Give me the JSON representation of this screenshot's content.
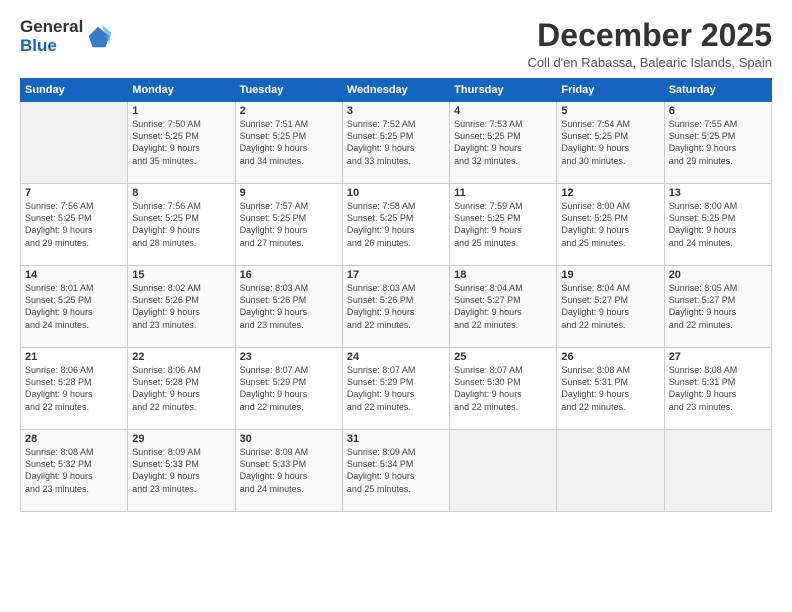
{
  "logo": {
    "general": "General",
    "blue": "Blue"
  },
  "title": "December 2025",
  "location": "Coll d'en Rabassa, Balearic Islands, Spain",
  "headers": [
    "Sunday",
    "Monday",
    "Tuesday",
    "Wednesday",
    "Thursday",
    "Friday",
    "Saturday"
  ],
  "weeks": [
    [
      {
        "day": "",
        "info": ""
      },
      {
        "day": "1",
        "info": "Sunrise: 7:50 AM\nSunset: 5:25 PM\nDaylight: 9 hours\nand 35 minutes."
      },
      {
        "day": "2",
        "info": "Sunrise: 7:51 AM\nSunset: 5:25 PM\nDaylight: 9 hours\nand 34 minutes."
      },
      {
        "day": "3",
        "info": "Sunrise: 7:52 AM\nSunset: 5:25 PM\nDaylight: 9 hours\nand 33 minutes."
      },
      {
        "day": "4",
        "info": "Sunrise: 7:53 AM\nSunset: 5:25 PM\nDaylight: 9 hours\nand 32 minutes."
      },
      {
        "day": "5",
        "info": "Sunrise: 7:54 AM\nSunset: 5:25 PM\nDaylight: 9 hours\nand 30 minutes."
      },
      {
        "day": "6",
        "info": "Sunrise: 7:55 AM\nSunset: 5:25 PM\nDaylight: 9 hours\nand 29 minutes."
      }
    ],
    [
      {
        "day": "7",
        "info": "Sunrise: 7:56 AM\nSunset: 5:25 PM\nDaylight: 9 hours\nand 29 minutes."
      },
      {
        "day": "8",
        "info": "Sunrise: 7:56 AM\nSunset: 5:25 PM\nDaylight: 9 hours\nand 28 minutes."
      },
      {
        "day": "9",
        "info": "Sunrise: 7:57 AM\nSunset: 5:25 PM\nDaylight: 9 hours\nand 27 minutes."
      },
      {
        "day": "10",
        "info": "Sunrise: 7:58 AM\nSunset: 5:25 PM\nDaylight: 9 hours\nand 26 minutes."
      },
      {
        "day": "11",
        "info": "Sunrise: 7:59 AM\nSunset: 5:25 PM\nDaylight: 9 hours\nand 25 minutes."
      },
      {
        "day": "12",
        "info": "Sunrise: 8:00 AM\nSunset: 5:25 PM\nDaylight: 9 hours\nand 25 minutes."
      },
      {
        "day": "13",
        "info": "Sunrise: 8:00 AM\nSunset: 5:25 PM\nDaylight: 9 hours\nand 24 minutes."
      }
    ],
    [
      {
        "day": "14",
        "info": "Sunrise: 8:01 AM\nSunset: 5:25 PM\nDaylight: 9 hours\nand 24 minutes."
      },
      {
        "day": "15",
        "info": "Sunrise: 8:02 AM\nSunset: 5:26 PM\nDaylight: 9 hours\nand 23 minutes."
      },
      {
        "day": "16",
        "info": "Sunrise: 8:03 AM\nSunset: 5:26 PM\nDaylight: 9 hours\nand 23 minutes."
      },
      {
        "day": "17",
        "info": "Sunrise: 8:03 AM\nSunset: 5:26 PM\nDaylight: 9 hours\nand 22 minutes."
      },
      {
        "day": "18",
        "info": "Sunrise: 8:04 AM\nSunset: 5:27 PM\nDaylight: 9 hours\nand 22 minutes."
      },
      {
        "day": "19",
        "info": "Sunrise: 8:04 AM\nSunset: 5:27 PM\nDaylight: 9 hours\nand 22 minutes."
      },
      {
        "day": "20",
        "info": "Sunrise: 8:05 AM\nSunset: 5:27 PM\nDaylight: 9 hours\nand 22 minutes."
      }
    ],
    [
      {
        "day": "21",
        "info": "Sunrise: 8:06 AM\nSunset: 5:28 PM\nDaylight: 9 hours\nand 22 minutes."
      },
      {
        "day": "22",
        "info": "Sunrise: 8:06 AM\nSunset: 5:28 PM\nDaylight: 9 hours\nand 22 minutes."
      },
      {
        "day": "23",
        "info": "Sunrise: 8:07 AM\nSunset: 5:29 PM\nDaylight: 9 hours\nand 22 minutes."
      },
      {
        "day": "24",
        "info": "Sunrise: 8:07 AM\nSunset: 5:29 PM\nDaylight: 9 hours\nand 22 minutes."
      },
      {
        "day": "25",
        "info": "Sunrise: 8:07 AM\nSunset: 5:30 PM\nDaylight: 9 hours\nand 22 minutes."
      },
      {
        "day": "26",
        "info": "Sunrise: 8:08 AM\nSunset: 5:31 PM\nDaylight: 9 hours\nand 22 minutes."
      },
      {
        "day": "27",
        "info": "Sunrise: 8:08 AM\nSunset: 5:31 PM\nDaylight: 9 hours\nand 23 minutes."
      }
    ],
    [
      {
        "day": "28",
        "info": "Sunrise: 8:08 AM\nSunset: 5:32 PM\nDaylight: 9 hours\nand 23 minutes."
      },
      {
        "day": "29",
        "info": "Sunrise: 8:09 AM\nSunset: 5:33 PM\nDaylight: 9 hours\nand 23 minutes."
      },
      {
        "day": "30",
        "info": "Sunrise: 8:09 AM\nSunset: 5:33 PM\nDaylight: 9 hours\nand 24 minutes."
      },
      {
        "day": "31",
        "info": "Sunrise: 8:09 AM\nSunset: 5:34 PM\nDaylight: 9 hours\nand 25 minutes."
      },
      {
        "day": "",
        "info": ""
      },
      {
        "day": "",
        "info": ""
      },
      {
        "day": "",
        "info": ""
      }
    ]
  ]
}
